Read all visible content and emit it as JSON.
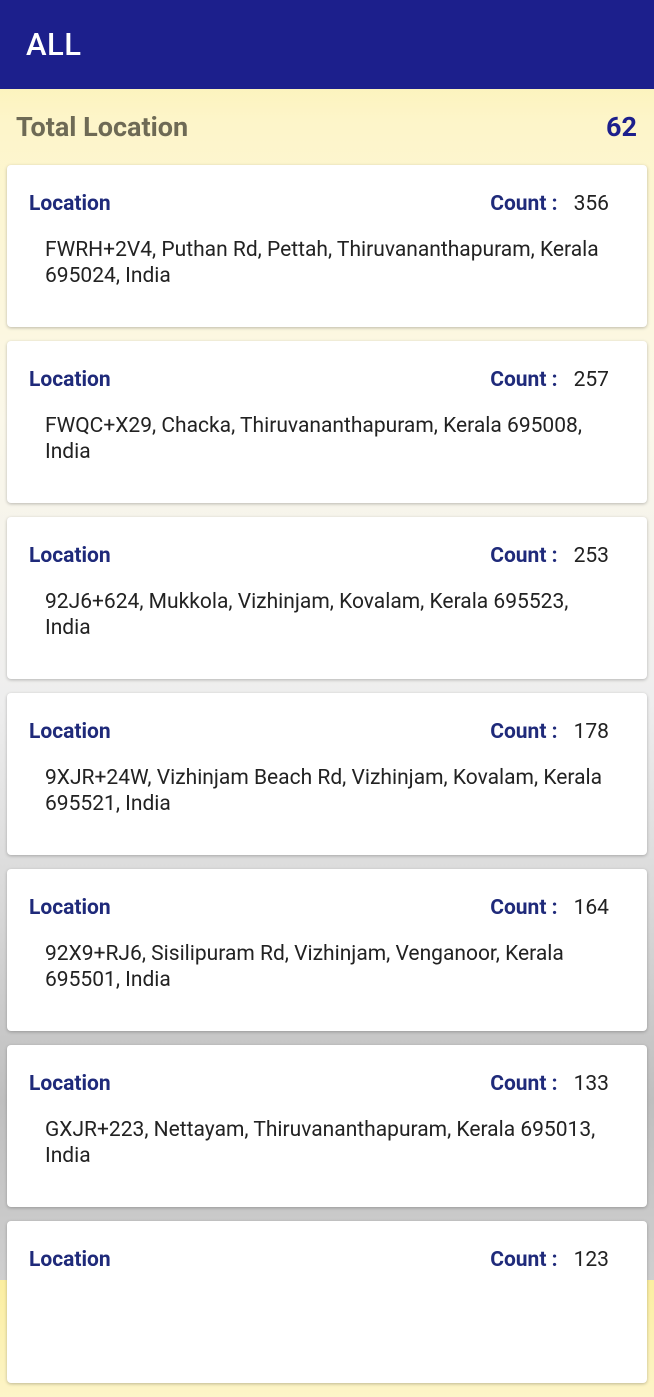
{
  "header": {
    "title": "ALL"
  },
  "summary": {
    "label": "Total Location",
    "total": "62"
  },
  "card_labels": {
    "location": "Location",
    "count": "Count :"
  },
  "locations": [
    {
      "count": "356",
      "address": "FWRH+2V4, Puthan Rd, Pettah, Thiruvananthapuram, Kerala 695024, India"
    },
    {
      "count": "257",
      "address": "FWQC+X29, Chacka, Thiruvananthapuram, Kerala 695008, India"
    },
    {
      "count": "253",
      "address": "92J6+624, Mukkola, Vizhinjam, Kovalam, Kerala 695523, India"
    },
    {
      "count": "178",
      "address": "9XJR+24W, Vizhinjam Beach Rd, Vizhinjam, Kovalam, Kerala 695521, India"
    },
    {
      "count": "164",
      "address": "92X9+RJ6, Sisilipuram Rd, Vizhinjam, Venganoor, Kerala 695501, India"
    },
    {
      "count": "133",
      "address": "GXJR+223, Nettayam, Thiruvananthapuram, Kerala 695013, India"
    },
    {
      "count": "123",
      "address": ""
    }
  ]
}
